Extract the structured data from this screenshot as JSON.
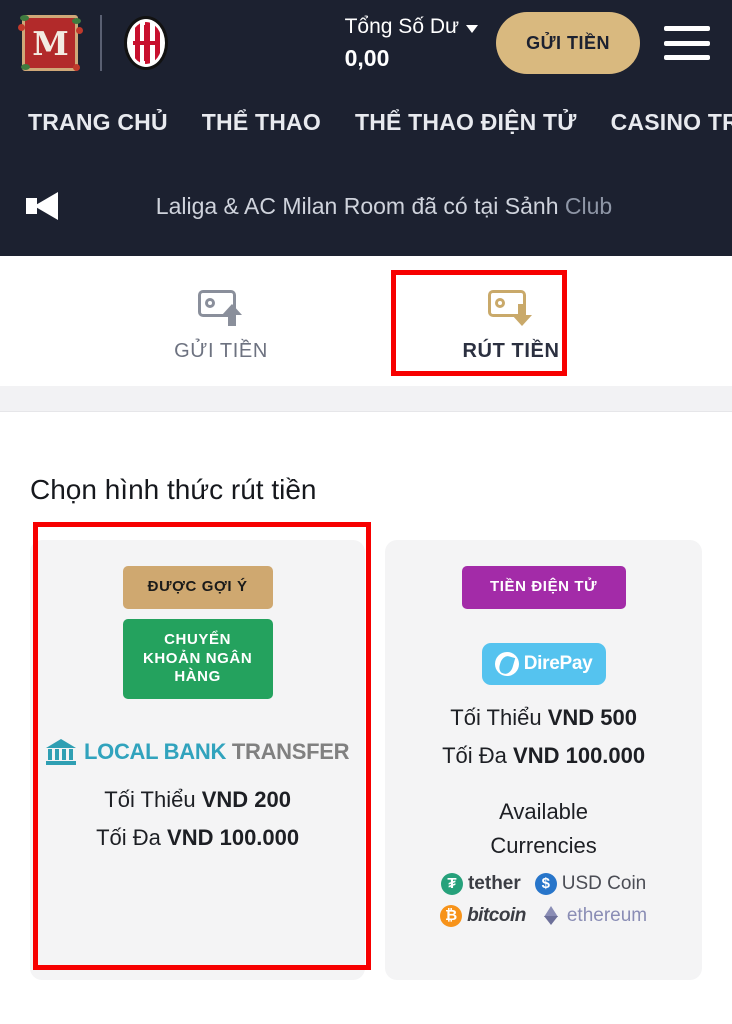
{
  "header": {
    "logo_letter": "M",
    "logo_name": "brand-logo",
    "partner_logo_name": "ac-milan-crest",
    "balance_label": "Tổng Số Dư",
    "balance_value": "0,00",
    "deposit_button": "GỬI TIỀN",
    "menu_icon": "hamburger-menu-icon",
    "background_color": "#1c2130",
    "accent_color": "#d9b97f"
  },
  "nav": {
    "items": [
      {
        "label": "TRANG CHỦ"
      },
      {
        "label": "THỂ THAO"
      },
      {
        "label": "THỂ THAO ĐIỆN TỬ"
      },
      {
        "label": "CASINO TRỰC TUY"
      }
    ]
  },
  "announcement": {
    "icon": "megaphone-icon",
    "text": "Laliga & AC Milan Room đã có tại Sảnh ",
    "text_dim": "Club"
  },
  "tabs": [
    {
      "label": "GỬI TIỀN",
      "icon": "wallet-up-arrow-icon",
      "active": false
    },
    {
      "label": "RÚT TIỀN",
      "icon": "wallet-down-arrow-icon",
      "active": true
    }
  ],
  "main": {
    "section_title": "Chọn hình thức rút tiền",
    "cards": [
      {
        "badge_recommended": "ĐƯỢC GỢI Ý",
        "badge_type": "CHUYỂN KHOẢN NGÂN HÀNG",
        "logo_name": "local-bank-transfer-logo",
        "logo_text_primary": "LOCAL BANK",
        "logo_text_secondary": "TRANSFER",
        "min_label": "Tối Thiểu ",
        "min_value": "VND 200",
        "max_label": "Tối Đa ",
        "max_value": "VND 100.000",
        "highlighted": true
      },
      {
        "badge_type": "TIỀN ĐIỆN TỬ",
        "logo_name": "direpay-logo",
        "logo_text": "DirePay",
        "min_label": "Tối Thiểu ",
        "min_value": "VND 500",
        "max_label": "Tối Đa ",
        "max_value": "VND 100.000",
        "available_title_line1": "Available",
        "available_title_line2": "Currencies",
        "currencies": [
          {
            "name": "tether",
            "symbol": "₮",
            "color": "#26a17b"
          },
          {
            "name": "USD Coin",
            "symbol": "$",
            "color": "#2775ca"
          },
          {
            "name": "bitcoin",
            "symbol": "₿",
            "color": "#f7931a"
          },
          {
            "name": "ethereum",
            "symbol": "",
            "color": "#8a8db5"
          }
        ],
        "highlighted": false
      }
    ]
  },
  "highlights": {
    "color": "#f70000",
    "tab_target": "RÚT TIỀN",
    "card_target": "CHUYỂN KHOẢN NGÂN HÀNG"
  }
}
